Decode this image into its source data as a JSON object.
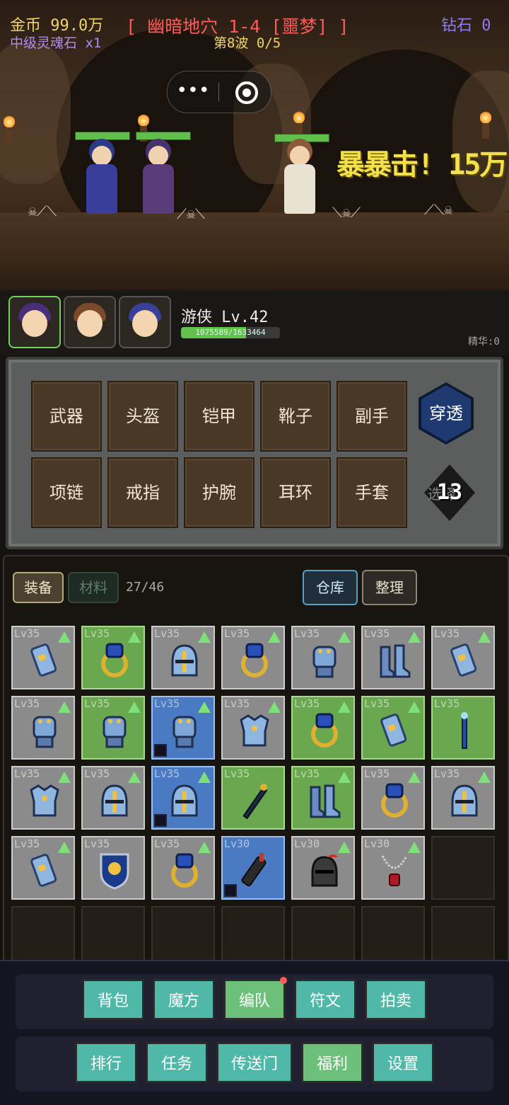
{
  "hud": {
    "gold": "金币 99.0万",
    "soul_stone": "中级灵魂石 x1",
    "stage": "[ 幽暗地穴 1-4 [噩梦] ]",
    "wave": "第8波 0/5",
    "diamond": "钻石 0",
    "damage_text": "暴暴击! 15万"
  },
  "hero": {
    "name_level": "游侠 Lv.42",
    "xp_text": "1075589/1633464",
    "xp_fraction": 0.658,
    "essence": "精华:0"
  },
  "equip_slots": {
    "row1": [
      "武器",
      "头盔",
      "铠甲",
      "靴子",
      "副手"
    ],
    "row2": [
      "项链",
      "戒指",
      "护腕",
      "耳环",
      "手套"
    ],
    "penetrate": "穿透",
    "level_badge": "13",
    "badge_sub": "选择"
  },
  "inventory": {
    "tab_equip": "装备",
    "tab_material": "材料",
    "count": "27/46",
    "warehouse": "仓库",
    "sort": "整理",
    "items": [
      {
        "lv": "Lv35",
        "rarity": "gray",
        "icon": "bracer-icon"
      },
      {
        "lv": "Lv35",
        "rarity": "green",
        "icon": "ring-icon"
      },
      {
        "lv": "Lv35",
        "rarity": "gray",
        "icon": "helmet-icon"
      },
      {
        "lv": "Lv35",
        "rarity": "gray",
        "icon": "ring-icon"
      },
      {
        "lv": "Lv35",
        "rarity": "gray",
        "icon": "gauntlet-icon"
      },
      {
        "lv": "Lv35",
        "rarity": "gray",
        "icon": "boots-icon"
      },
      {
        "lv": "Lv35",
        "rarity": "gray",
        "icon": "bracer-icon"
      },
      {
        "lv": "Lv35",
        "rarity": "gray",
        "icon": "gauntlet-icon"
      },
      {
        "lv": "Lv35",
        "rarity": "green",
        "icon": "gauntlet-icon"
      },
      {
        "lv": "Lv35",
        "rarity": "blue",
        "icon": "gauntlet-icon"
      },
      {
        "lv": "Lv35",
        "rarity": "gray",
        "icon": "armor-icon"
      },
      {
        "lv": "Lv35",
        "rarity": "green",
        "icon": "ring-icon"
      },
      {
        "lv": "Lv35",
        "rarity": "green",
        "icon": "bracer-icon"
      },
      {
        "lv": "Lv35",
        "rarity": "green",
        "icon": "staff-icon"
      },
      {
        "lv": "Lv35",
        "rarity": "gray",
        "icon": "armor-icon"
      },
      {
        "lv": "Lv35",
        "rarity": "gray",
        "icon": "helmet-icon"
      },
      {
        "lv": "Lv35",
        "rarity": "blue",
        "icon": "helmet-icon"
      },
      {
        "lv": "Lv35",
        "rarity": "green",
        "icon": "scepter-icon"
      },
      {
        "lv": "Lv35",
        "rarity": "green",
        "icon": "boots-icon"
      },
      {
        "lv": "Lv35",
        "rarity": "gray",
        "icon": "ring-icon"
      },
      {
        "lv": "Lv35",
        "rarity": "gray",
        "icon": "helmet-icon"
      },
      {
        "lv": "Lv35",
        "rarity": "gray",
        "icon": "bracer-icon"
      },
      {
        "lv": "Lv35",
        "rarity": "gray",
        "icon": "shield-icon"
      },
      {
        "lv": "Lv35",
        "rarity": "gray",
        "icon": "ring-icon"
      },
      {
        "lv": "Lv30",
        "rarity": "blue",
        "icon": "quiver-icon"
      },
      {
        "lv": "Lv30",
        "rarity": "gray",
        "icon": "dark-helmet-icon"
      },
      {
        "lv": "Lv30",
        "rarity": "gray",
        "icon": "necklace-icon"
      }
    ]
  },
  "nav": {
    "row1": [
      "背包",
      "魔方",
      "编队",
      "符文",
      "拍卖"
    ],
    "row2": [
      "排行",
      "任务",
      "传送门",
      "福利",
      "设置"
    ]
  },
  "colors": {
    "gold": "#f0d36a",
    "stage_red": "#ff5a5a",
    "wave_yellow": "#f0d36a",
    "diamond_purple": "#8e7cf0",
    "soul_purple": "#b48af0"
  }
}
